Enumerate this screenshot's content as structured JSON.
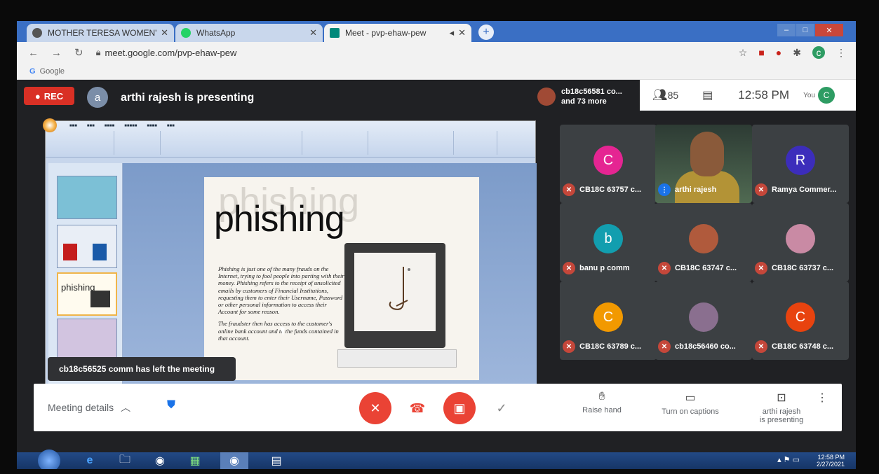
{
  "browser": {
    "tabs": [
      {
        "label": "MOTHER TERESA WOMEN'S UNI",
        "icon": "globe-icon",
        "color": "#555555"
      },
      {
        "label": "WhatsApp",
        "icon": "whatsapp-icon",
        "color": "#25d366"
      },
      {
        "label": "Meet - pvp-ehaw-pew",
        "icon": "meet-icon",
        "color": "#00897b"
      }
    ],
    "url": "meet.google.com/pvp-ehaw-pew",
    "bookmark": "Google"
  },
  "meet": {
    "rec_label": "REC",
    "presenter_initial": "a",
    "presenting_text": "arthi rajesh is presenting",
    "others_line1": "cb18c56581 co...",
    "others_line2": "and 73 more",
    "participant_count": "85",
    "time": "12:58 PM",
    "you_label": "You",
    "you_initial": "C",
    "toast": "cb18c56525 comm has left the meeting",
    "participants": [
      {
        "initial": "C",
        "name": "CB18C 63757 c...",
        "color": "#e52592"
      },
      {
        "initial": "",
        "name": "arthi rajesh",
        "color": "",
        "video": true
      },
      {
        "initial": "R",
        "name": "Ramya Commer...",
        "color": "#3c2dbb"
      },
      {
        "initial": "b",
        "name": "banu p comm",
        "color": "#129eaf"
      },
      {
        "initial": "",
        "name": "CB18C 63747 c...",
        "color": "#b05a3c"
      },
      {
        "initial": "",
        "name": "CB18C 63737 c...",
        "color": "#c98aa4"
      },
      {
        "initial": "C",
        "name": "CB18C 63789 c...",
        "color": "#f29900"
      },
      {
        "initial": "",
        "name": "cb18c56460 co...",
        "color": "#8a6f8f"
      },
      {
        "initial": "C",
        "name": "CB18C 63748 c...",
        "color": "#e8430f"
      }
    ],
    "controls": {
      "meeting_details": "Meeting details",
      "raise_hand": "Raise hand",
      "captions": "Turn on captions",
      "present_line1": "arthi rajesh",
      "present_line2": "is presenting"
    }
  },
  "slide": {
    "title": "phishing",
    "ghost": "phishing",
    "para1": "Phishing is just one of the many frauds on the Internet, trying to fool people into parting with their money. Phishing refers to the receipt of unsolicited emails by customers of Financial Institutions, requesting them to enter their Username, Password or other personal information to access their Account for some reason.",
    "para2": "The fraudster then has access to the customer's online bank account and to the funds contained in that account.",
    "thumb_label": "phishing"
  },
  "taskbar": {
    "time": "12:58 PM",
    "date": "2/27/2021"
  }
}
